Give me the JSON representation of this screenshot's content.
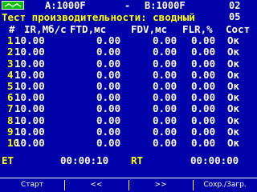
{
  "status_bar": {
    "port_a": "A:1000F",
    "separator": "-",
    "port_b": "B:1000F",
    "time": "02 05",
    "battery_icon": "battery-icon"
  },
  "title": "Тест производительности: сводный",
  "table": {
    "headers": [
      "#",
      "IR,Мб/с",
      "FTD,мс",
      "FDV,мс",
      "FLR,%",
      "Сост"
    ],
    "rows": [
      [
        "1",
        "10.00",
        "0.00",
        "0.00",
        "0.00",
        "Ок"
      ],
      [
        "2",
        "10.00",
        "0.00",
        "0.00",
        "0.00",
        "Ок"
      ],
      [
        "3",
        "10.00",
        "0.00",
        "0.00",
        "0.00",
        "Ок"
      ],
      [
        "4",
        "10.00",
        "0.00",
        "0.00",
        "0.00",
        "Ок"
      ],
      [
        "5",
        "10.00",
        "0.00",
        "0.00",
        "0.00",
        "Ок"
      ],
      [
        "6",
        "10.00",
        "0.00",
        "0.00",
        "0.00",
        "Ок"
      ],
      [
        "7",
        "10.00",
        "0.00",
        "0.00",
        "0.00",
        "Ок"
      ],
      [
        "8",
        "10.00",
        "0.00",
        "0.00",
        "0.00",
        "Ок"
      ],
      [
        "9",
        "10.00",
        "0.00",
        "0.00",
        "0.00",
        "Ок"
      ],
      [
        "10",
        "10.00",
        "0.00",
        "0.00",
        "0.00",
        "Ок"
      ]
    ]
  },
  "timing": {
    "et_label": "ET",
    "et_value": "00:00:10",
    "rt_label": "RT",
    "rt_value": "00:00:00"
  },
  "softkeys": {
    "start": "Старт",
    "prev": "<<",
    "next": ">>",
    "save": "Сохр./Загр."
  },
  "colors": {
    "background": "#0000aa",
    "title": "#ffff00",
    "text": "#ffffff",
    "battery": "#00c000"
  }
}
